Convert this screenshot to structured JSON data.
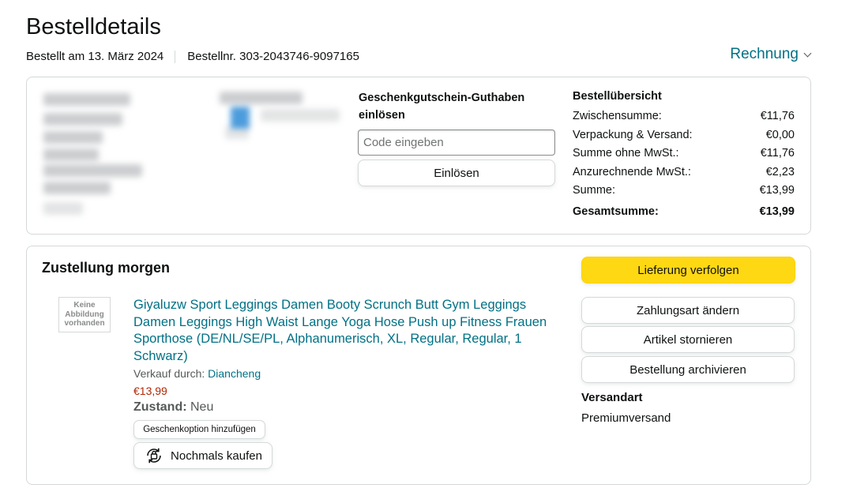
{
  "header": {
    "title": "Bestelldetails",
    "order_date": "Bestellt am 13. März 2024",
    "order_number": "Bestellnr. 303-2043746-9097165",
    "invoice_label": "Rechnung"
  },
  "gift_card": {
    "title": "Geschenkgutschein-Guthaben einlösen",
    "input_placeholder": "Code eingeben",
    "redeem_label": "Einlösen"
  },
  "order_summary": {
    "title": "Bestellübersicht",
    "rows": [
      {
        "label": "Zwischensumme:",
        "value": "€11,76"
      },
      {
        "label": "Verpackung & Versand:",
        "value": "€0,00"
      },
      {
        "label": "Summe ohne MwSt.:",
        "value": "€11,76"
      },
      {
        "label": "Anzurechnende MwSt.:",
        "value": "€2,23"
      },
      {
        "label": "Summe:",
        "value": "€13,99"
      }
    ],
    "total": {
      "label": "Gesamtsumme:",
      "value": "€13,99"
    }
  },
  "delivery": {
    "title": "Zustellung morgen",
    "item": {
      "no_image_text": "Keine Abbildung vorhanden",
      "title": "Giyaluzw Sport Leggings Damen Booty Scrunch Butt Gym Leggings Damen Leggings High Waist Lange Yoga Hose Push up Fitness Frauen Sporthose (DE/NL/SE/PL, Alphanumerisch, XL, Regular, Regular, 1 Schwarz)",
      "sold_by_label": "Verkauf durch:",
      "seller": "Diancheng",
      "price": "€13,99",
      "condition_label": "Zustand:",
      "condition_value": "Neu",
      "gift_option_label": "Geschenkoption hinzufügen",
      "buy_again_label": "Nochmals kaufen"
    },
    "actions": {
      "track": "Lieferung verfolgen",
      "change_payment": "Zahlungsart ändern",
      "cancel": "Artikel stornieren",
      "archive": "Bestellung archivieren"
    },
    "shipping_label": "Versandart",
    "shipping_value": "Premiumversand"
  },
  "colors": {
    "link": "#007185",
    "price": "#b12704",
    "primary_button": "#ffd814",
    "border": "#d5d9d9"
  }
}
